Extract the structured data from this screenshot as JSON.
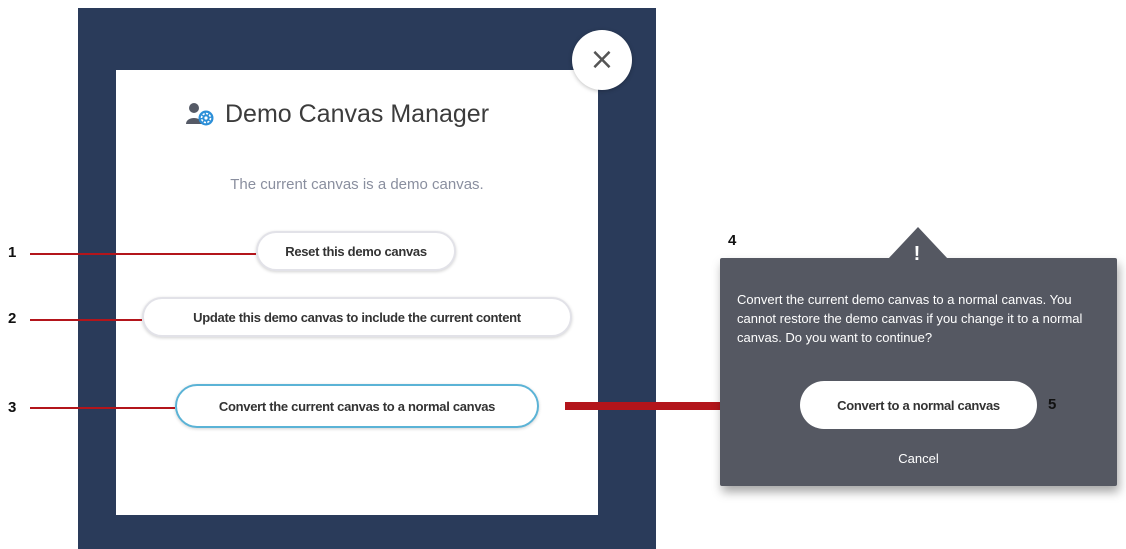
{
  "dialog": {
    "title": "Demo Canvas Manager",
    "title_icon": "user-settings-icon",
    "subtitle": "The current canvas is a demo canvas.",
    "close_icon": "close-icon",
    "close_glyph": "×",
    "buttons": {
      "reset": "Reset this demo canvas",
      "update": "Update this demo canvas to include the current content",
      "convert": "Convert the current canvas to a normal canvas"
    }
  },
  "markers": {
    "m1": "1",
    "m2": "2",
    "m3": "3",
    "m4": "4",
    "m5": "5"
  },
  "popup": {
    "warning_icon": "exclamation-icon",
    "warning_glyph": "!",
    "message": "Convert the current demo canvas to a normal canvas. You cannot restore the demo canvas if you change it to a normal canvas. Do you want to continue?",
    "confirm_label": "Convert to a normal canvas",
    "cancel_label": "Cancel"
  },
  "colors": {
    "backdrop": "#2a3b5a",
    "annotation_red": "#b3151b",
    "popup_bg": "#555862",
    "primary_border": "#5bb3d6"
  }
}
